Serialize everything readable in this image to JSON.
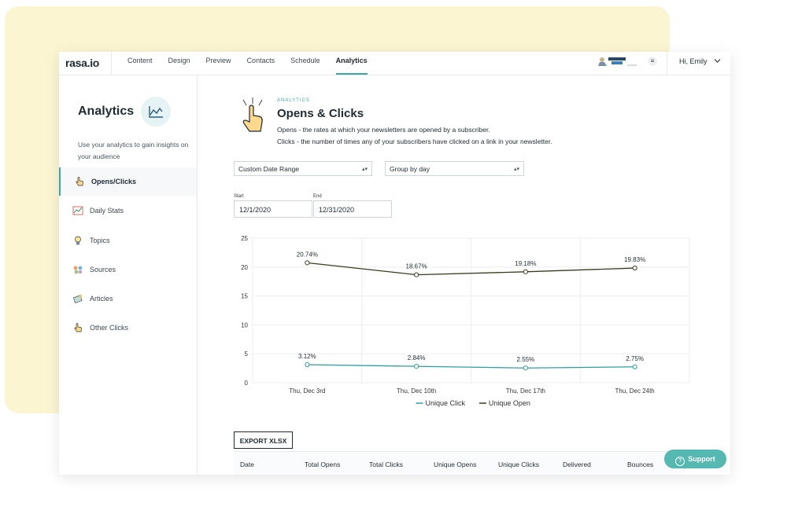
{
  "app": {
    "logo": "rasa.io"
  },
  "nav": {
    "items": [
      {
        "label": "Content"
      },
      {
        "label": "Design"
      },
      {
        "label": "Preview"
      },
      {
        "label": "Contacts"
      },
      {
        "label": "Schedule"
      },
      {
        "label": "Analytics",
        "active": true
      }
    ]
  },
  "header": {
    "user_greeting": "Hi, Emily",
    "menu_icon": "≡"
  },
  "sidebar": {
    "title": "Analytics",
    "description": "Use your analytics to gain insights on your audience",
    "items": [
      {
        "label": "Opens/Clicks",
        "active": true,
        "icon": "hand-pointer-icon"
      },
      {
        "label": "Daily Stats",
        "icon": "line-chart-icon"
      },
      {
        "label": "Topics",
        "icon": "lightbulb-icon"
      },
      {
        "label": "Sources",
        "icon": "sources-icon"
      },
      {
        "label": "Articles",
        "icon": "articles-icon"
      },
      {
        "label": "Other Clicks",
        "icon": "hand-pointer-icon"
      }
    ]
  },
  "main": {
    "eyebrow": "ANALYTICS",
    "title": "Opens & Clicks",
    "desc_opens": "Opens - the rates at which your newsletters are opened by a subscriber.",
    "desc_clicks": "Clicks - the number of times any of your subscribers have clicked on a link in your newsletter.",
    "date_range_select": "Custom Date Range",
    "group_select": "Group by day",
    "start_label": "Start",
    "start_value": "12/1/2020",
    "end_label": "End",
    "end_value": "12/31/2020",
    "export_label": "EXPORT XLSX",
    "table_headers": [
      "Date",
      "Total Opens",
      "Total Clicks",
      "Unique Opens",
      "Unique Clicks",
      "Delivered",
      "Bounces"
    ]
  },
  "support": {
    "label": "Support"
  },
  "colors": {
    "accent": "#3aa9a3",
    "open_line": "#3b3b1e",
    "click_line": "#2f9ea0",
    "support": "#55b9b1"
  },
  "chart_data": {
    "type": "line",
    "categories": [
      "Thu, Dec 3rd",
      "Thu, Dec 10th",
      "Thu, Dec 17th",
      "Thu, Dec 24th"
    ],
    "ylim": [
      0,
      25
    ],
    "yticks": [
      0,
      5,
      10,
      15,
      20,
      25
    ],
    "series": [
      {
        "name": "Unique Open",
        "values": [
          20.74,
          18.67,
          19.18,
          19.83
        ],
        "labels": [
          "20.74%",
          "18.67%",
          "19.18%",
          "19.83%"
        ],
        "color": "#3b3b1e"
      },
      {
        "name": "Unique Click",
        "values": [
          3.12,
          2.84,
          2.55,
          2.75
        ],
        "labels": [
          "3.12%",
          "2.84%",
          "2.55%",
          "2.75%"
        ],
        "color": "#2f9ea0"
      }
    ],
    "legend": "bottom",
    "legend_order": [
      "Unique Click",
      "Unique Open"
    ],
    "grid": true
  }
}
